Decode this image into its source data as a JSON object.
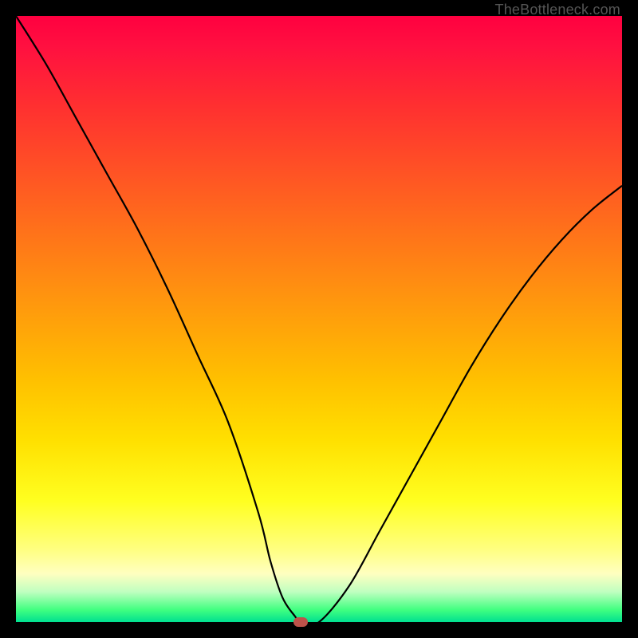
{
  "watermark": "TheBottleneck.com",
  "colors": {
    "frame": "#000000",
    "curve": "#000000",
    "marker": "#bd524a"
  },
  "chart_data": {
    "type": "line",
    "title": "",
    "xlabel": "",
    "ylabel": "",
    "xlim": [
      0,
      100
    ],
    "ylim": [
      0,
      100
    ],
    "grid": false,
    "legend": false,
    "series": [
      {
        "name": "bottleneck-curve",
        "x": [
          0,
          5,
          10,
          15,
          20,
          25,
          30,
          35,
          40,
          42,
          44,
          46,
          47,
          50,
          55,
          60,
          65,
          70,
          75,
          80,
          85,
          90,
          95,
          100
        ],
        "y": [
          100,
          92,
          83,
          74,
          65,
          55,
          44,
          33,
          18,
          10,
          4,
          1,
          0,
          0,
          6,
          15,
          24,
          33,
          42,
          50,
          57,
          63,
          68,
          72
        ]
      }
    ],
    "marker": {
      "x": 47,
      "y": 0
    },
    "background_gradient": {
      "orientation": "vertical",
      "stops": [
        {
          "pos": 0.0,
          "color": "#ff0040"
        },
        {
          "pos": 0.3,
          "color": "#ff6020"
        },
        {
          "pos": 0.6,
          "color": "#ffc000"
        },
        {
          "pos": 0.8,
          "color": "#ffff20"
        },
        {
          "pos": 0.95,
          "color": "#c0ffc0"
        },
        {
          "pos": 1.0,
          "color": "#00e090"
        }
      ]
    }
  }
}
